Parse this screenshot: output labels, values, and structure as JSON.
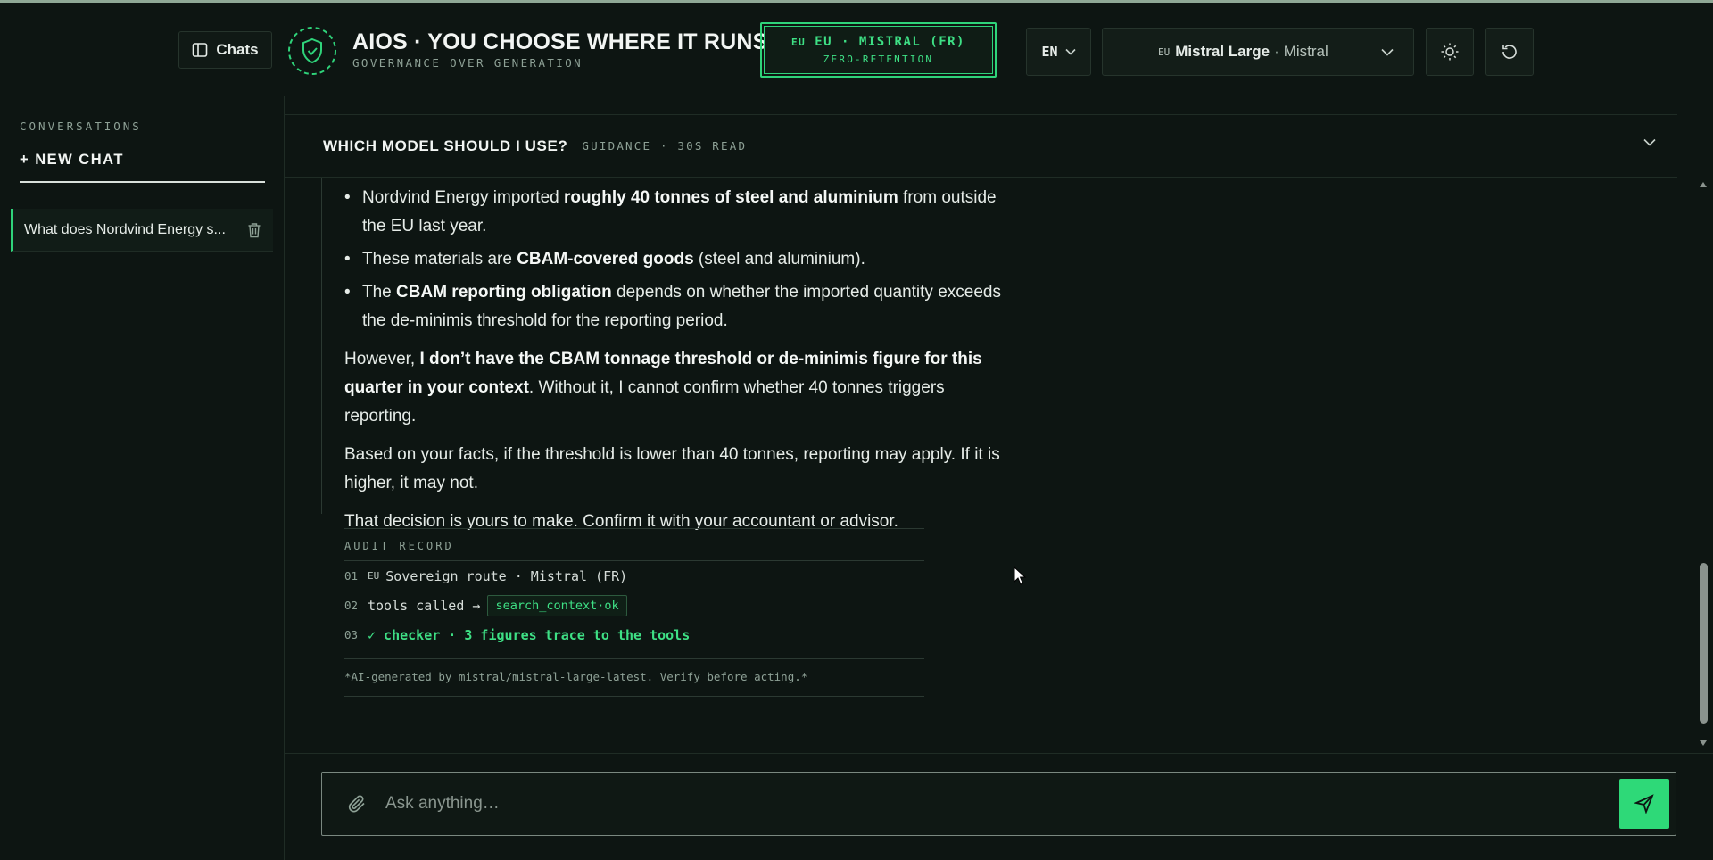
{
  "header": {
    "chats_label": "Chats",
    "brand_title": "AIOS · YOU CHOOSE WHERE IT RUNS",
    "brand_subtitle": "GOVERNANCE OVER GENERATION",
    "route_badge": {
      "flag": "EU",
      "line1": "EU · MISTRAL (FR)",
      "line2": "ZERO-RETENTION"
    },
    "language": "EN",
    "model": {
      "flag": "EU",
      "name": "Mistral Large",
      "separator": "·",
      "provider": "Mistral"
    }
  },
  "sidebar": {
    "section_label": "CONVERSATIONS",
    "new_chat_label": "+ NEW CHAT",
    "conversations": [
      {
        "title": "What does Nordvind Energy s..."
      }
    ]
  },
  "guidance": {
    "title": "WHICH MODEL SHOULD I USE?",
    "subtitle": "GUIDANCE · 30S READ"
  },
  "answer": {
    "bullets": [
      {
        "pre": "Nordvind Energy imported ",
        "bold": "roughly 40 tonnes of steel and aluminium",
        "post": " from outside the EU last year."
      },
      {
        "pre": "These materials are ",
        "bold": "CBAM-covered goods",
        "post": " (steel and aluminium)."
      },
      {
        "pre": "The ",
        "bold": "CBAM reporting obligation",
        "post": " depends on whether the imported quantity exceeds the de-minimis threshold for the reporting period."
      }
    ],
    "para1": {
      "pre": "However, ",
      "bold": "I don’t have the CBAM tonnage threshold or de-minimis figure for this quarter in your context",
      "post": ". Without it, I cannot confirm whether 40 tonnes triggers reporting."
    },
    "para2": "Based on your facts, if the threshold is lower than 40 tonnes, reporting may apply. If it is higher, it may not.",
    "para3": "That decision is yours to make. Confirm it with your accountant or advisor."
  },
  "audit": {
    "title": "AUDIT RECORD",
    "rows": [
      {
        "num": "01",
        "flag": "EU",
        "text": "Sovereign route · Mistral (FR)"
      },
      {
        "num": "02",
        "text": "tools called →",
        "tag": "search_context·ok"
      },
      {
        "num": "03",
        "text": "✓ checker · 3 figures trace to the tools"
      }
    ],
    "footer": "*AI-generated by mistral/mistral-large-latest. Verify before acting.*"
  },
  "composer": {
    "placeholder": "Ask anything…"
  },
  "colors": {
    "accent": "#2ed978",
    "background": "#0d1512",
    "border": "#1f2c25"
  },
  "icons": {
    "chats": "sidebar-panel-icon",
    "logo": "shield-check-icon",
    "theme": "sun-icon",
    "reset": "refresh-icon",
    "delete": "trash-icon",
    "attach": "paperclip-icon",
    "send": "send-icon"
  }
}
